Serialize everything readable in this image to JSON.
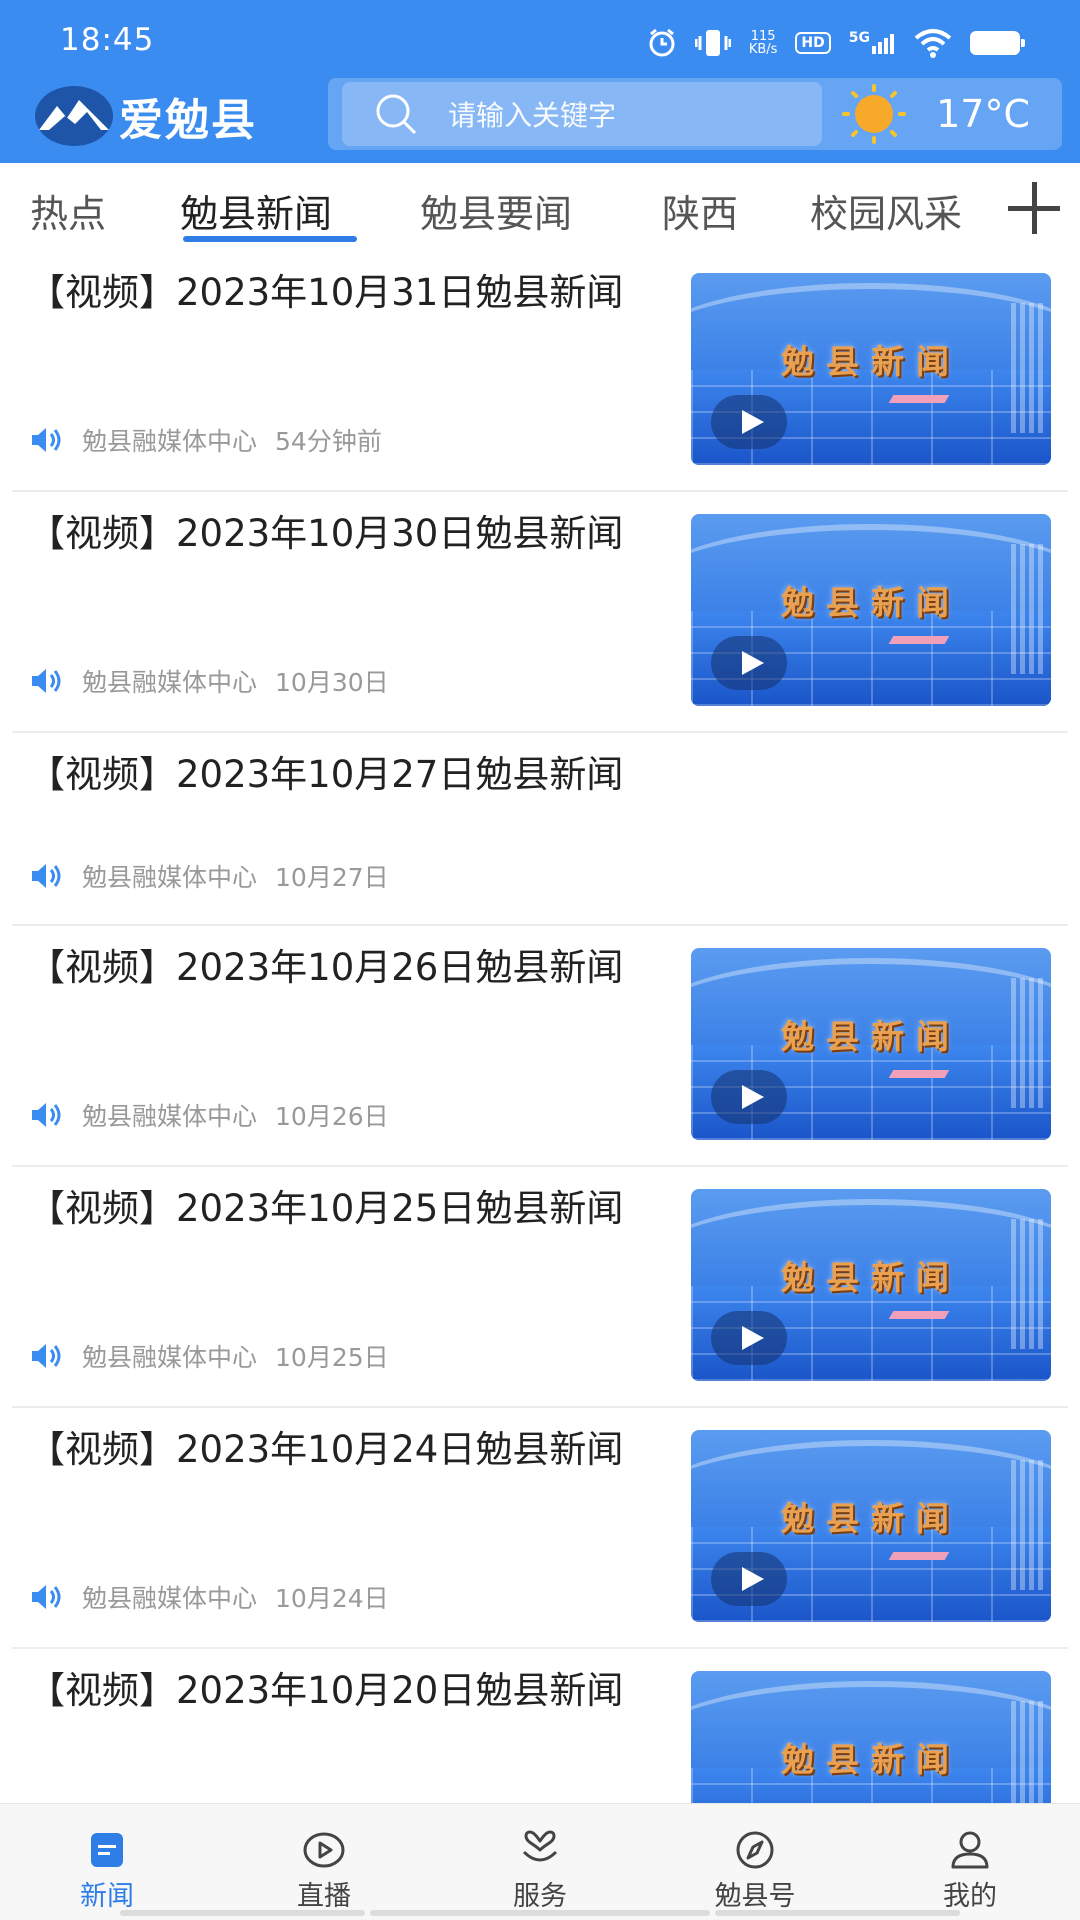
{
  "status_bar": {
    "time": "18:45",
    "net_speed_value": "115",
    "net_speed_unit": "KB/s",
    "hd": "HD",
    "signal": "5G"
  },
  "app": {
    "name": "爱勉县",
    "search_placeholder": "请输入关键字",
    "temperature": "17°C",
    "accent_color": "#3b8cf0"
  },
  "tabs": [
    {
      "label": "热点"
    },
    {
      "label": "勉县新闻",
      "active": true
    },
    {
      "label": "勉县要闻"
    },
    {
      "label": "陕西"
    },
    {
      "label": "校园风采"
    }
  ],
  "thumbnail_title": "勉县新闻",
  "news": [
    {
      "title": "【视频】2023年10月31日勉县新闻",
      "source": "勉县融媒体中心",
      "time": "54分钟前"
    },
    {
      "title": "【视频】2023年10月30日勉县新闻",
      "source": "勉县融媒体中心",
      "time": "10月30日"
    },
    {
      "title": "【视频】2023年10月27日勉县新闻",
      "source": "勉县融媒体中心",
      "time": "10月27日"
    },
    {
      "title": "【视频】2023年10月26日勉县新闻",
      "source": "勉县融媒体中心",
      "time": "10月26日"
    },
    {
      "title": "【视频】2023年10月25日勉县新闻",
      "source": "勉县融媒体中心",
      "time": "10月25日"
    },
    {
      "title": "【视频】2023年10月24日勉县新闻",
      "source": "勉县融媒体中心",
      "time": "10月24日"
    },
    {
      "title": "【视频】2023年10月20日勉县新闻"
    }
  ],
  "bottom_nav": [
    {
      "label": "新闻",
      "icon": "news-icon",
      "active": true
    },
    {
      "label": "直播",
      "icon": "live-icon"
    },
    {
      "label": "服务",
      "icon": "service-icon"
    },
    {
      "label": "勉县号",
      "icon": "compass-icon"
    },
    {
      "label": "我的",
      "icon": "profile-icon"
    }
  ]
}
